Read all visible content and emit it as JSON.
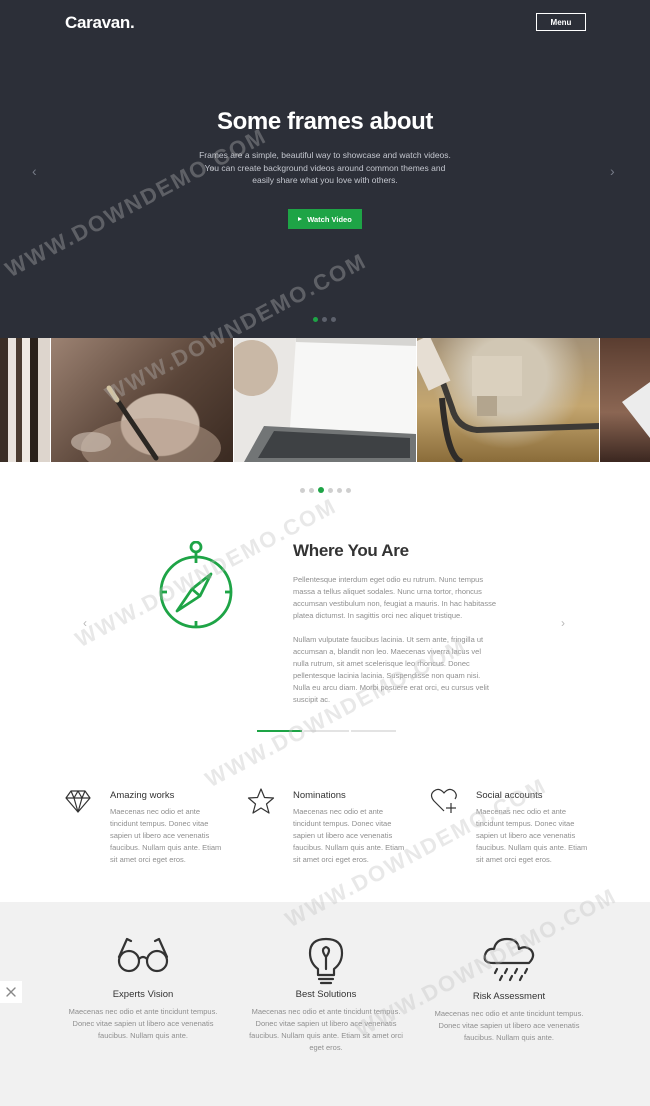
{
  "header": {
    "logo": "Caravan.",
    "menu_label": "Menu"
  },
  "hero": {
    "title": "Some frames about",
    "text": "Frames are a simple, beautiful way to showcase and watch videos. You can create background videos around common themes and easily share what you love with others.",
    "cta_label": "Watch Video",
    "dots": 3,
    "active_dot": 0
  },
  "gallery": {
    "photos": [
      "photo-1",
      "photo-2",
      "photo-3",
      "photo-4",
      "photo-5"
    ]
  },
  "slider": {
    "dots": 6,
    "active_dot": 2
  },
  "where": {
    "title": "Where You Are",
    "paragraph1": "Pellentesque interdum eget odio eu rutrum. Nunc tempus massa a tellus aliquet sodales. Nunc urna tortor, rhoncus accumsan vestibulum non, feugiat a mauris. In hac habitasse platea dictumst. In sagittis orci nec aliquet tristique.",
    "paragraph2": "Nullam vulputate faucibus lacinia. Ut sem ante, fringilla ut accumsan a, blandit non leo. Maecenas viverra lacus vel nulla rutrum, sit amet scelerisque leo rhoncus. Donec pellentesque lacinia lacinia. Suspendisse non quam nisi. Nulla eu arcu diam. Morbi posuere erat orci, eu cursus velit suscipit ac.",
    "tabs": 3,
    "active_tab": 0
  },
  "features": [
    {
      "icon": "diamond-icon",
      "title": "Amazing works",
      "text": "Maecenas nec odio et ante tincidunt tempus. Donec vitae sapien ut libero ace venenatis faucibus. Nullam quis ante. Etiam sit amet orci eget eros."
    },
    {
      "icon": "star-icon",
      "title": "Nominations",
      "text": "Maecenas nec odio et ante tincidunt tempus. Donec vitae sapien ut libero ace venenatis faucibus. Nullam quis ante. Etiam sit amet orci eget eros."
    },
    {
      "icon": "heart-plus-icon",
      "title": "Social accounts",
      "text": "Maecenas nec odio et ante tincidunt tempus. Donec vitae sapien ut libero ace venenatis faucibus. Nullam quis ante. Etiam sit amet orci eget eros."
    }
  ],
  "services": [
    {
      "icon": "glasses-icon",
      "title": "Experts Vision",
      "text": "Maecenas nec odio et ante tincidunt tempus. Donec vitae sapien ut libero ace venenatis faucibus. Nullam quis ante."
    },
    {
      "icon": "lightbulb-icon",
      "title": "Best Solutions",
      "text": "Maecenas nec odio et ante tincidunt tempus. Donec vitae sapien ut libero ace venenatis faucibus. Nullam quis ante. Etiam sit amet orci eget eros."
    },
    {
      "icon": "rain-cloud-icon",
      "title": "Risk Assessment",
      "text": "Maecenas nec odio et ante tincidunt tempus. Donec vitae sapien ut libero ace venenatis faucibus. Nullam quis ante."
    }
  ],
  "watermark": "WWW.DOWNDEMO.COM",
  "colors": {
    "hero_bg": "#2c2f38",
    "accent": "#1ea446",
    "band_bg": "#f1f1f1"
  }
}
